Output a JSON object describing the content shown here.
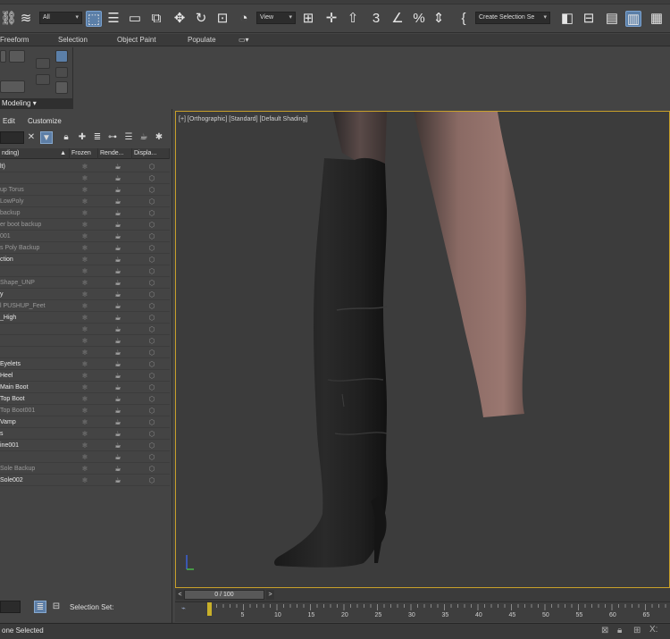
{
  "toolbar": {
    "filter_dropdown": "All",
    "view_dropdown": "View",
    "named_selection": "Create Selection Se"
  },
  "ribbon_tabs": [
    "Freeform",
    "Selection",
    "Object Paint",
    "Populate"
  ],
  "ribbon_panel_label": "Modeling",
  "explorer": {
    "menu": [
      "Edit",
      "Customize"
    ],
    "columns": [
      "nding)",
      "Frozen",
      "Rende...",
      "Displa..."
    ],
    "rows": [
      {
        "name": "lt)",
        "dim": false
      },
      {
        "name": "",
        "dim": false
      },
      {
        "name": "up Torus",
        "dim": true
      },
      {
        "name": "LowPoly",
        "dim": true
      },
      {
        "name": "backup",
        "dim": true
      },
      {
        "name": "er boot backup",
        "dim": true
      },
      {
        "name": "001",
        "dim": true
      },
      {
        "name": "s Poly Backup",
        "dim": true
      },
      {
        "name": "ction",
        "dim": false
      },
      {
        "name": "",
        "dim": false
      },
      {
        "name": "Shape_UNP",
        "dim": true
      },
      {
        "name": "y",
        "dim": false
      },
      {
        "name": "l PUSHUP_Feet",
        "dim": true
      },
      {
        "name": "_High",
        "dim": false
      },
      {
        "name": "",
        "dim": false
      },
      {
        "name": "",
        "dim": false
      },
      {
        "name": "",
        "dim": false
      },
      {
        "name": "Eyelets",
        "dim": false
      },
      {
        "name": "Heel",
        "dim": false
      },
      {
        "name": "Main Boot",
        "dim": false
      },
      {
        "name": "Top Boot",
        "dim": false
      },
      {
        "name": "Top Boot001",
        "dim": true
      },
      {
        "name": "Vamp",
        "dim": false
      },
      {
        "name": "s",
        "dim": false
      },
      {
        "name": "ine001",
        "dim": false
      },
      {
        "name": "",
        "dim": false
      },
      {
        "name": "Sole Backup",
        "dim": true
      },
      {
        "name": "Sole002",
        "dim": false
      }
    ],
    "selection_set_label": "Selection Set:"
  },
  "viewport": {
    "label": "[+] [Orthographic] [Standard] [Default Shading]"
  },
  "timeslider": {
    "frame": "0 / 100",
    "ticks": [
      "5",
      "10",
      "15",
      "20",
      "25",
      "30",
      "35",
      "40",
      "45",
      "50",
      "55",
      "60",
      "65"
    ]
  },
  "status": {
    "text": "one Selected"
  },
  "colors": {
    "viewport_border": "#c8a02a",
    "selected_tool": "#5b7fa8"
  }
}
